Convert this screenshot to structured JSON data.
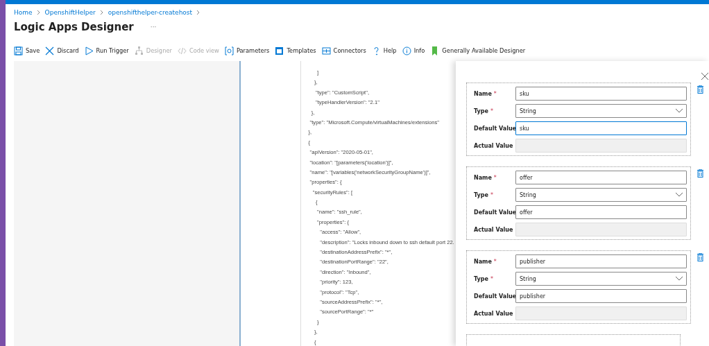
{
  "breadcrumb": [
    "Home",
    "OpenshiftHelper",
    "openshifthelper-createhost"
  ],
  "title": "Logic Apps Designer",
  "more": "···",
  "toolbar": [
    {
      "kind": "save",
      "label": "Save",
      "disabled": false
    },
    {
      "kind": "discard",
      "label": "Discard",
      "disabled": false
    },
    {
      "kind": "run",
      "label": "Run Trigger",
      "disabled": false
    },
    {
      "kind": "designer",
      "label": "Designer",
      "disabled": true
    },
    {
      "kind": "code",
      "label": "Code view",
      "disabled": true
    },
    {
      "kind": "parameters",
      "label": "Parameters",
      "disabled": false
    },
    {
      "kind": "templates",
      "label": "Templates",
      "disabled": false
    },
    {
      "kind": "connectors",
      "label": "Connectors",
      "disabled": false
    },
    {
      "kind": "help",
      "label": "Help",
      "disabled": false
    },
    {
      "kind": "info",
      "label": "Info",
      "disabled": false
    },
    {
      "kind": "bookmark",
      "label": "Generally Available Designer",
      "disabled": false
    }
  ],
  "code_lines": [
    "          ]",
    "        },",
    "         \"type\": \"CustomScript\",",
    "         \"typeHandlerVersion\": \"2.1\"",
    "      },",
    "     \"type\": \"Microsoft.Compute/virtualMachines/extensions\"",
    "    },",
    "    {",
    "     \"apiVersion\": \"2020-05-01\",",
    "     \"location\": \"[parameters('location')]\",",
    "     \"name\": \"[variables('networkSecurityGroupName')]\",",
    "     \"properties\": {",
    "       \"securityRules\": [",
    "         {",
    "          \"name\": \"ssh_rule\",",
    "          \"properties\": {",
    "            \"access\": \"Allow\",",
    "            \"description\": \"Locks inbound down to ssh default port 22.",
    "            \"destinationAddressPrefix\": \"*\",",
    "            \"destinationPortRange\": \"22\",",
    "            \"direction\": \"Inbound\",",
    "            \"priority\": 123,",
    "            \"protocol\": \"Tcp\",",
    "            \"sourceAddressPrefix\": \"*\",",
    "            \"sourcePortRange\": \"*\"",
    "          }",
    "        },",
    "        {"
  ],
  "parameters": [
    {
      "name_label": "Name",
      "type_label": "Type",
      "default_label": "Default Value",
      "actual_label": "Actual Value",
      "name": "sku",
      "type": "String",
      "default_value": "sku",
      "default_focused": true
    },
    {
      "name_label": "Name",
      "type_label": "Type",
      "default_label": "Default Value",
      "actual_label": "Actual Value",
      "name": "offer",
      "type": "String",
      "default_value": "offer",
      "default_focused": false
    },
    {
      "name_label": "Name",
      "type_label": "Type",
      "default_label": "Default Value",
      "actual_label": "Actual Value",
      "name": "publisher",
      "type": "String",
      "default_value": "publisher",
      "default_focused": false
    }
  ],
  "required_mark": "*"
}
